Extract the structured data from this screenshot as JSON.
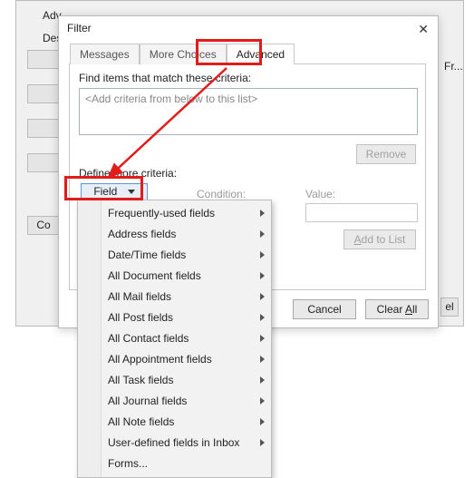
{
  "background": {
    "adv": "Adv",
    "desc": "Des(",
    "fr": "Fr...",
    "co": "Co",
    "el": "el"
  },
  "dialog": {
    "title": "Filter",
    "close": "✕",
    "tabs": {
      "messages": "Messages",
      "moreChoices": "More Choices",
      "advanced": "Advanced"
    },
    "findLabel": "Find items that match these criteria:",
    "criteriaPlaceholder": "<Add criteria from below to this list>",
    "removeLabel": "Remove",
    "defineLabel": "Define more criteria:",
    "fieldLabel": "Field",
    "conditionLabel": "Condition:",
    "valueLabel": "Value:",
    "addToList": "Add to List",
    "cancel": "Cancel",
    "clearAll": "Clear All"
  },
  "menu": {
    "items": [
      {
        "label": "Frequently-used fields",
        "submenu": true
      },
      {
        "label": "Address fields",
        "submenu": true
      },
      {
        "label": "Date/Time fields",
        "submenu": true
      },
      {
        "label": "All Document fields",
        "submenu": true
      },
      {
        "label": "All Mail fields",
        "submenu": true
      },
      {
        "label": "All Post fields",
        "submenu": true
      },
      {
        "label": "All Contact fields",
        "submenu": true
      },
      {
        "label": "All Appointment fields",
        "submenu": true
      },
      {
        "label": "All Task fields",
        "submenu": true
      },
      {
        "label": "All Journal fields",
        "submenu": true
      },
      {
        "label": "All Note fields",
        "submenu": true
      },
      {
        "label": "User-defined fields in Inbox",
        "submenu": true
      },
      {
        "label": "Forms...",
        "submenu": false
      }
    ]
  },
  "annotations": {
    "arrowColor": "#e21b1b"
  }
}
